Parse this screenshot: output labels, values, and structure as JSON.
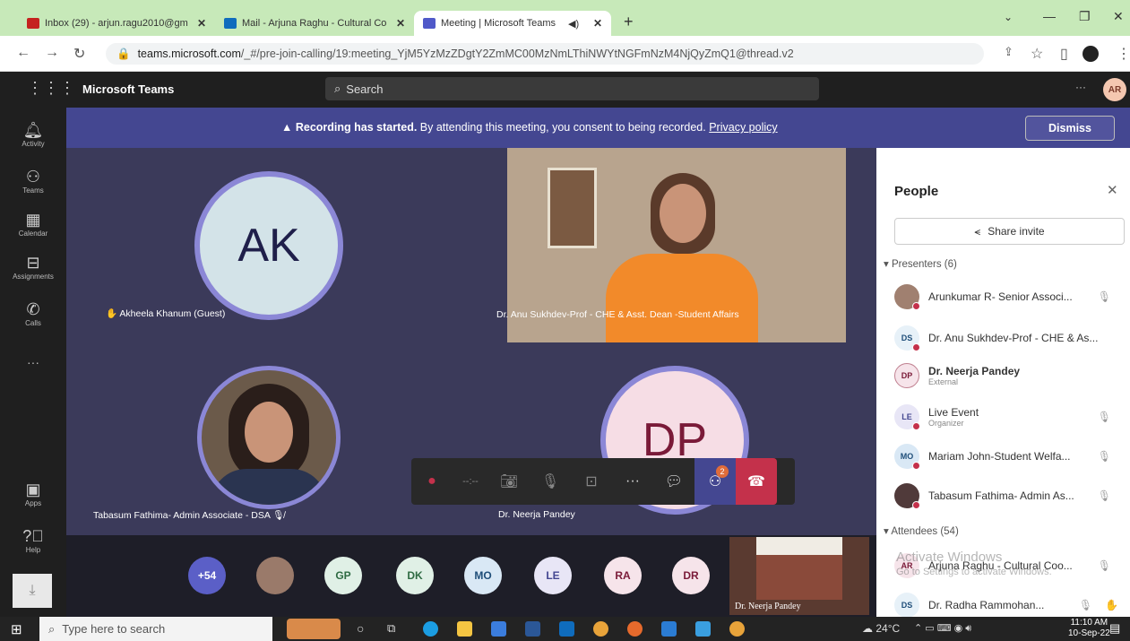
{
  "browser": {
    "tabs": [
      {
        "label": "Inbox (29) - arjun.ragu2010@gm",
        "color": "#c5221f"
      },
      {
        "label": "Mail - Arjuna Raghu - Cultural Co",
        "color": "#0f6cbd"
      },
      {
        "label": "Meeting | Microsoft Teams",
        "color": "#5059c9"
      }
    ],
    "url_host": "teams.microsoft.com",
    "url_path": "/_#/pre-join-calling/19:meeting_YjM5YzMzZDgtY2ZmMC00MzNmLThiNWYtNGFmNzM4NjQyZmQ1@thread.v2"
  },
  "teams": {
    "app_name": "Microsoft Teams",
    "search_placeholder": "Search",
    "profile_initials": "AR",
    "more": "···"
  },
  "rail": [
    {
      "label": "Activity",
      "icon": "bell-icon"
    },
    {
      "label": "Teams",
      "icon": "teams-icon"
    },
    {
      "label": "Calendar",
      "icon": "calendar-icon"
    },
    {
      "label": "Assignments",
      "icon": "assignments-icon"
    },
    {
      "label": "Calls",
      "icon": "phone-icon"
    },
    {
      "label": "···",
      "icon": "more-icon"
    },
    {
      "label": "Apps",
      "icon": "apps-icon"
    },
    {
      "label": "Help",
      "icon": "help-icon"
    }
  ],
  "banner": {
    "bold": "Recording has started.",
    "text": " By attending this meeting, you consent to being recorded. ",
    "link": "Privacy policy",
    "dismiss": "Dismiss"
  },
  "tiles": {
    "ak_initials": "AK",
    "ak_name": "Akheela Khanum (Guest)",
    "anu_name": "Dr. Anu Sukhdev-Prof - CHE & Asst. Dean -Student Affairs",
    "tabasum_name": "Tabasum Fathima- Admin Associate - DSA",
    "dp_initials": "DP",
    "dp_name": "Dr. Neerja Pandey",
    "screen_name": "Dr. Neerja Pandey"
  },
  "controls": {
    "timer": "--:--",
    "reactions_badge": "2"
  },
  "strip": [
    "+54",
    "",
    "GP",
    "DK",
    "MO",
    "LE",
    "RA",
    "DR"
  ],
  "people": {
    "title": "People",
    "share": "Share invite",
    "presenters_header": "Presenters (6)",
    "presenters": [
      {
        "initials": "",
        "name": "Arunkumar R- Senior Associ...",
        "sub": "",
        "bold": false,
        "bg": "#a08070"
      },
      {
        "initials": "DS",
        "name": "Dr. Anu Sukhdev-Prof - CHE & As...",
        "sub": "",
        "bold": false,
        "bg": "#e7f1f8"
      },
      {
        "initials": "DP",
        "name": "Dr. Neerja Pandey",
        "sub": "External",
        "bold": true,
        "bg": "#f6e4ea"
      },
      {
        "initials": "LE",
        "name": "Live Event",
        "sub": "Organizer",
        "bold": false,
        "bg": "#e8e6f6"
      },
      {
        "initials": "MO",
        "name": "Mariam John-Student Welfa...",
        "sub": "",
        "bold": false,
        "bg": "#d9e8f5"
      },
      {
        "initials": "",
        "name": "Tabasum Fathima- Admin As...",
        "sub": "",
        "bold": false,
        "bg": "#503a3a"
      }
    ],
    "attendees_header": "Attendees (54)",
    "attendees": [
      {
        "initials": "AR",
        "name": "Arjuna Raghu - Cultural Coo...",
        "bg": "#f6e4ea"
      },
      {
        "initials": "DS",
        "name": "Dr. Radha Rammohan...",
        "bg": "#e7f1f8"
      }
    ],
    "watermark1": "Activate Windows",
    "watermark2": "Go to Settings to activate Windows."
  },
  "taskbar": {
    "search": "Type here to search",
    "weather": "24°C",
    "time": "11:10 AM",
    "date": "10-Sep-22"
  }
}
